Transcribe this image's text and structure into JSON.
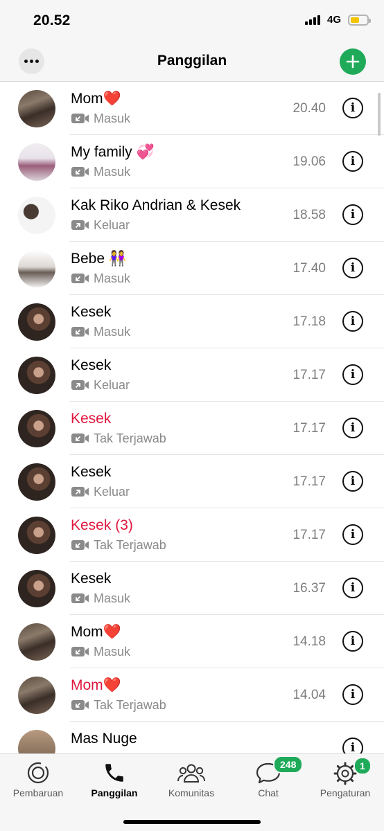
{
  "status_bar": {
    "time": "20.52",
    "network": "4G"
  },
  "nav": {
    "title": "Panggilan",
    "more_icon": "ellipsis-icon",
    "add_icon": "plus-icon",
    "accent": "#1faa59"
  },
  "calls": [
    {
      "name": "Mom❤️",
      "type": "Masuk",
      "direction": "incoming",
      "missed": false,
      "time": "20.40"
    },
    {
      "name": "My family 💞",
      "type": "Masuk",
      "direction": "incoming",
      "missed": false,
      "time": "19.06"
    },
    {
      "name": "Kak Riko Andrian & Kesek",
      "type": "Keluar",
      "direction": "outgoing",
      "missed": false,
      "time": "18.58"
    },
    {
      "name": "Bebe 👭",
      "type": "Masuk",
      "direction": "incoming",
      "missed": false,
      "time": "17.40"
    },
    {
      "name": "Kesek",
      "type": "Masuk",
      "direction": "incoming",
      "missed": false,
      "time": "17.18"
    },
    {
      "name": "Kesek",
      "type": "Keluar",
      "direction": "outgoing",
      "missed": false,
      "time": "17.17"
    },
    {
      "name": "Kesek",
      "type": "Tak Terjawab",
      "direction": "incoming",
      "missed": true,
      "time": "17.17"
    },
    {
      "name": "Kesek",
      "type": "Keluar",
      "direction": "outgoing",
      "missed": false,
      "time": "17.17"
    },
    {
      "name": "Kesek  (3)",
      "type": "Tak Terjawab",
      "direction": "incoming",
      "missed": true,
      "time": "17.17"
    },
    {
      "name": "Kesek",
      "type": "Masuk",
      "direction": "incoming",
      "missed": false,
      "time": "16.37"
    },
    {
      "name": "Mom❤️",
      "type": "Masuk",
      "direction": "incoming",
      "missed": false,
      "time": "14.18"
    },
    {
      "name": "Mom❤️",
      "type": "Tak Terjawab",
      "direction": "incoming",
      "missed": true,
      "time": "14.04"
    },
    {
      "name": "Mas Nuge",
      "type": "",
      "direction": "incoming",
      "missed": false,
      "time": ""
    }
  ],
  "colors": {
    "missed": "#e0173f",
    "secondary": "#8a8a8a"
  },
  "tabs": [
    {
      "label": "Pembaruan",
      "icon": "updates-icon",
      "active": false
    },
    {
      "label": "Panggilan",
      "icon": "phone-icon",
      "active": true
    },
    {
      "label": "Komunitas",
      "icon": "communities-icon",
      "active": false
    },
    {
      "label": "Chat",
      "icon": "chat-icon",
      "active": false,
      "badge": "248"
    },
    {
      "label": "Pengaturan",
      "icon": "settings-icon",
      "active": false,
      "badge": "1"
    }
  ]
}
